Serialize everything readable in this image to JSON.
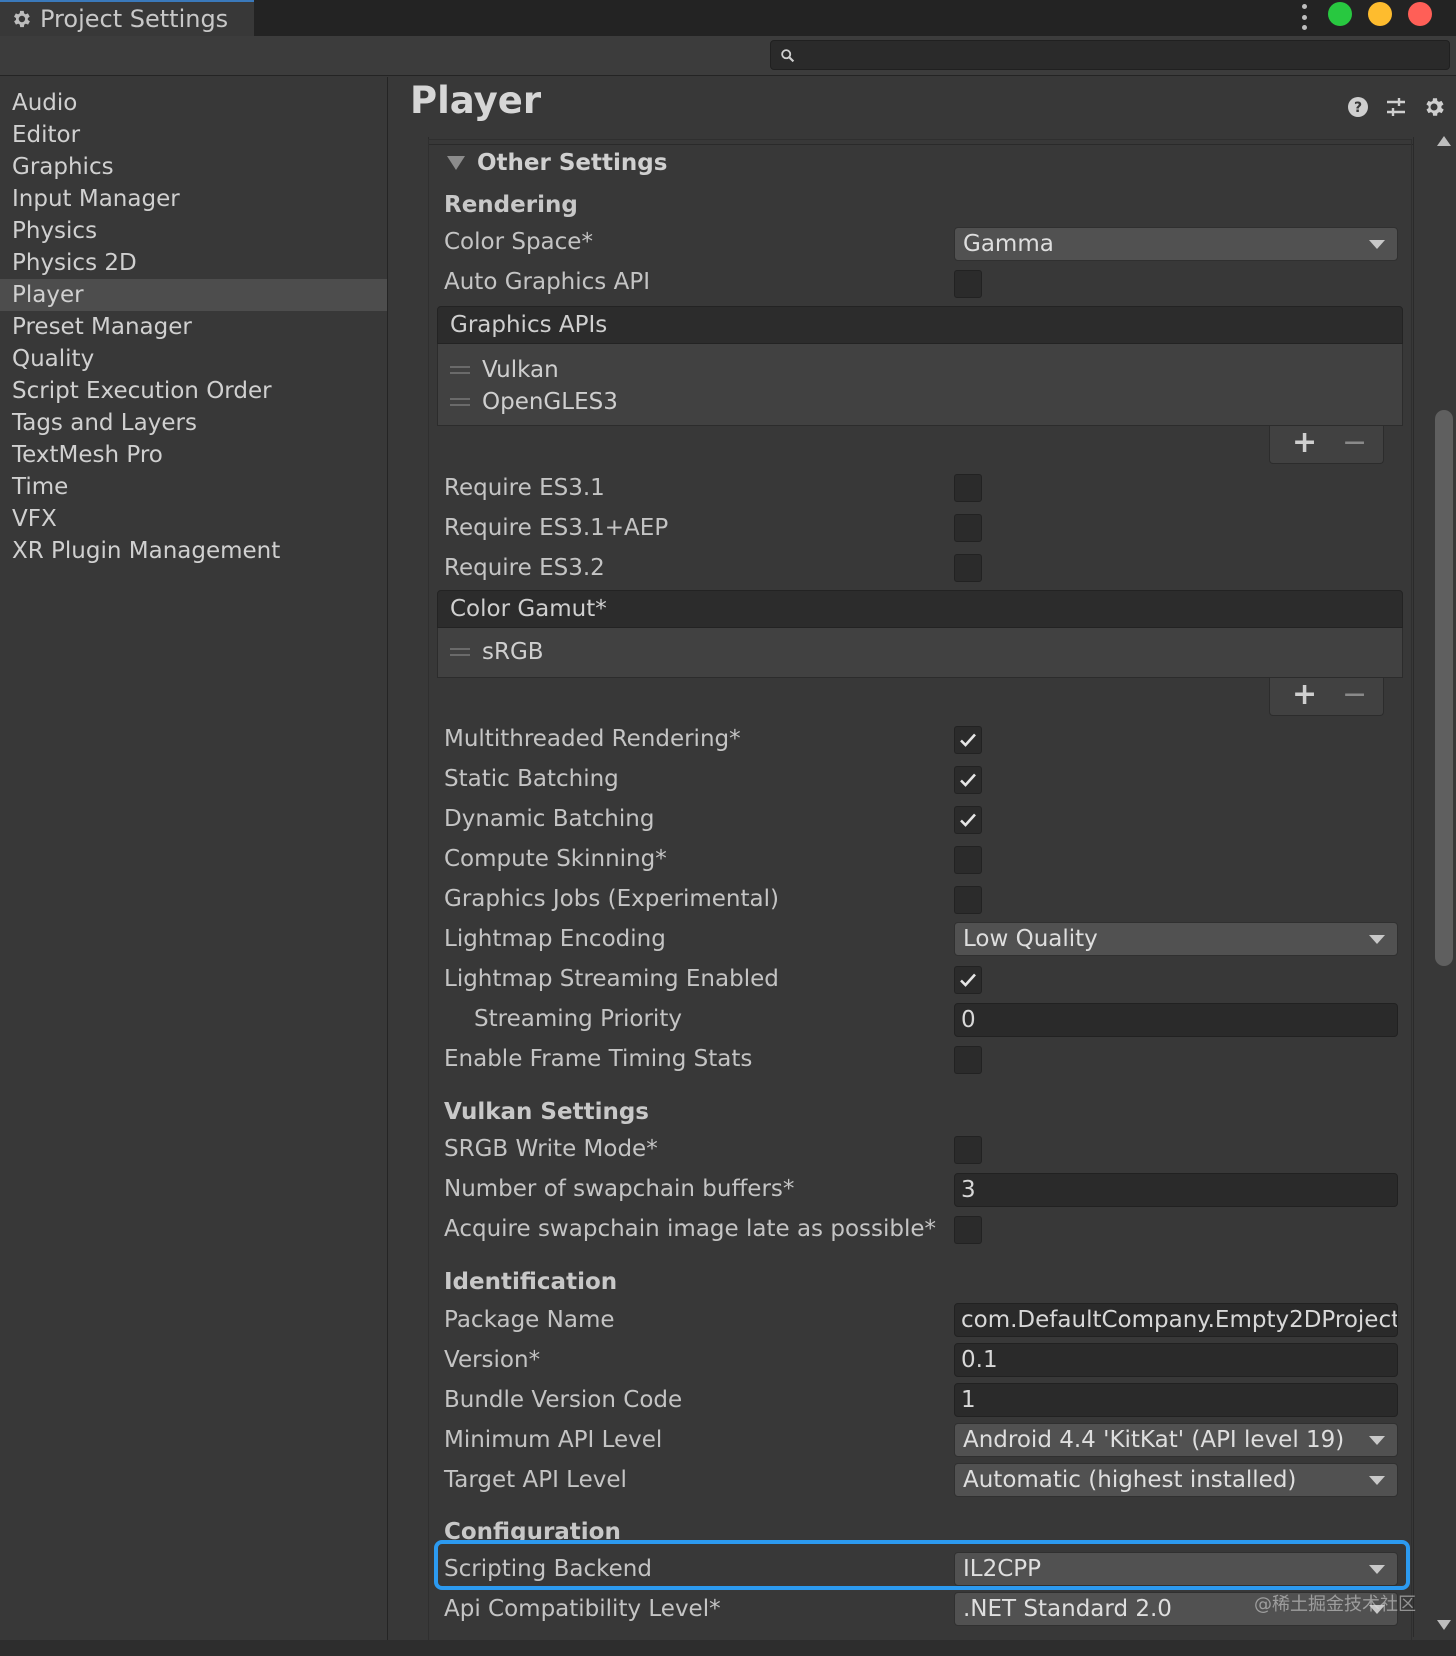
{
  "window": {
    "tab_title": "Project Settings",
    "traffic_lights": [
      "#28c840",
      "#febc2e",
      "#ff5f57"
    ]
  },
  "search": {
    "placeholder": "",
    "value": ""
  },
  "sidebar": {
    "items": [
      {
        "label": "Audio"
      },
      {
        "label": "Editor"
      },
      {
        "label": "Graphics"
      },
      {
        "label": "Input Manager"
      },
      {
        "label": "Physics"
      },
      {
        "label": "Physics 2D"
      },
      {
        "label": "Player",
        "selected": true
      },
      {
        "label": "Preset Manager"
      },
      {
        "label": "Quality"
      },
      {
        "label": "Script Execution Order"
      },
      {
        "label": "Tags and Layers"
      },
      {
        "label": "TextMesh Pro"
      },
      {
        "label": "Time"
      },
      {
        "label": "VFX"
      },
      {
        "label": "XR Plugin Management"
      }
    ]
  },
  "main": {
    "title": "Player",
    "section": "Other Settings",
    "rendering": {
      "header": "Rendering",
      "color_space_label": "Color Space*",
      "color_space_value": "Gamma",
      "auto_graphics_api_label": "Auto Graphics API",
      "auto_graphics_api": false,
      "graphics_apis_header": "Graphics APIs",
      "graphics_apis": [
        "Vulkan",
        "OpenGLES3"
      ],
      "require_es31_label": "Require ES3.1",
      "require_es31": false,
      "require_es31_aep_label": "Require ES3.1+AEP",
      "require_es31_aep": false,
      "require_es32_label": "Require ES3.2",
      "require_es32": false,
      "color_gamut_header": "Color Gamut*",
      "color_gamut": [
        "sRGB"
      ],
      "multithreaded_label": "Multithreaded Rendering*",
      "multithreaded": true,
      "static_batching_label": "Static Batching",
      "static_batching": true,
      "dynamic_batching_label": "Dynamic Batching",
      "dynamic_batching": true,
      "compute_skinning_label": "Compute Skinning*",
      "compute_skinning": false,
      "graphics_jobs_label": "Graphics Jobs (Experimental)",
      "graphics_jobs": false,
      "lightmap_encoding_label": "Lightmap Encoding",
      "lightmap_encoding_value": "Low Quality",
      "lightmap_streaming_label": "Lightmap Streaming Enabled",
      "lightmap_streaming": true,
      "streaming_priority_label": "Streaming Priority",
      "streaming_priority_value": "0",
      "frame_timing_label": "Enable Frame Timing Stats",
      "frame_timing": false
    },
    "vulkan": {
      "header": "Vulkan Settings",
      "srgb_write_label": "SRGB Write Mode*",
      "srgb_write": false,
      "swapchain_label": "Number of swapchain buffers*",
      "swapchain_value": "3",
      "acquire_late_label": "Acquire swapchain image late as possible*",
      "acquire_late": false
    },
    "identification": {
      "header": "Identification",
      "package_name_label": "Package Name",
      "package_name_value": "com.DefaultCompany.Empty2DProject",
      "version_label": "Version*",
      "version_value": "0.1",
      "bundle_code_label": "Bundle Version Code",
      "bundle_code_value": "1",
      "min_api_label": "Minimum API Level",
      "min_api_value": "Android 4.4 'KitKat' (API level 19)",
      "target_api_label": "Target API Level",
      "target_api_value": "Automatic (highest installed)"
    },
    "configuration": {
      "header": "Configuration",
      "scripting_backend_label": "Scripting Backend",
      "scripting_backend_value": "IL2CPP",
      "api_compat_label": "Api Compatibility Level*",
      "api_compat_value": ".NET Standard 2.0"
    }
  },
  "watermark": "@稀土掘金技术社区",
  "colors": {
    "highlight": "#2c9af0",
    "accent": "#3a79bb"
  }
}
